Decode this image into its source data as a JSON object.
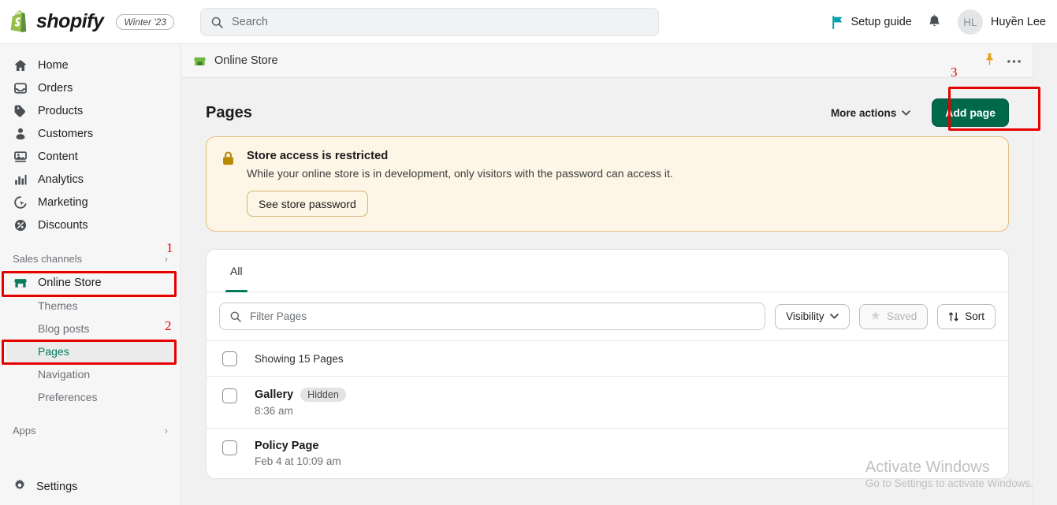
{
  "topbar": {
    "brand": "shopify",
    "season_badge": "Winter '23",
    "search_placeholder": "Search",
    "setup_guide_label": "Setup guide",
    "avatar_initials": "HL",
    "user_name": "Huyền Lee"
  },
  "sidebar": {
    "items": [
      {
        "label": "Home",
        "icon": "home-icon"
      },
      {
        "label": "Orders",
        "icon": "orders-icon"
      },
      {
        "label": "Products",
        "icon": "tag-icon"
      },
      {
        "label": "Customers",
        "icon": "person-icon"
      },
      {
        "label": "Content",
        "icon": "content-icon"
      },
      {
        "label": "Analytics",
        "icon": "bar-chart-icon"
      },
      {
        "label": "Marketing",
        "icon": "marketing-target-icon"
      },
      {
        "label": "Discounts",
        "icon": "discount-percent-icon"
      }
    ],
    "sales_channels_label": "Sales channels",
    "online_store_label": "Online Store",
    "sub_items": [
      {
        "label": "Themes"
      },
      {
        "label": "Blog posts"
      },
      {
        "label": "Pages"
      },
      {
        "label": "Navigation"
      },
      {
        "label": "Preferences"
      }
    ],
    "apps_label": "Apps",
    "settings_label": "Settings"
  },
  "breadcrumb": {
    "label": "Online Store"
  },
  "page": {
    "title": "Pages",
    "more_actions_label": "More actions",
    "add_page_label": "Add page"
  },
  "banner": {
    "title": "Store access is restricted",
    "text": "While your online store is in development, only visitors with the password can access it.",
    "button_label": "See store password"
  },
  "tabs": [
    {
      "label": "All",
      "active": true
    }
  ],
  "filters": {
    "filter_placeholder": "Filter Pages",
    "visibility_label": "Visibility",
    "saved_label": "Saved",
    "sort_label": "Sort"
  },
  "list": {
    "showing_label": "Showing 15 Pages",
    "rows": [
      {
        "title": "Gallery",
        "badge": "Hidden",
        "subtitle": "8:36 am"
      },
      {
        "title": "Policy Page",
        "badge": "",
        "subtitle": "Feb 4 at 10:09 am"
      }
    ]
  },
  "annotations": [
    {
      "number": "1"
    },
    {
      "number": "2"
    },
    {
      "number": "3"
    }
  ],
  "watermark": {
    "title": "Activate Windows",
    "subtitle": "Go to Settings to activate Windows."
  },
  "colors": {
    "brand_green": "#00694a",
    "accent_green": "#007b5c",
    "annotation_red": "#e60000",
    "banner_bg": "#fdf5e6",
    "banner_border": "#e0c080"
  }
}
